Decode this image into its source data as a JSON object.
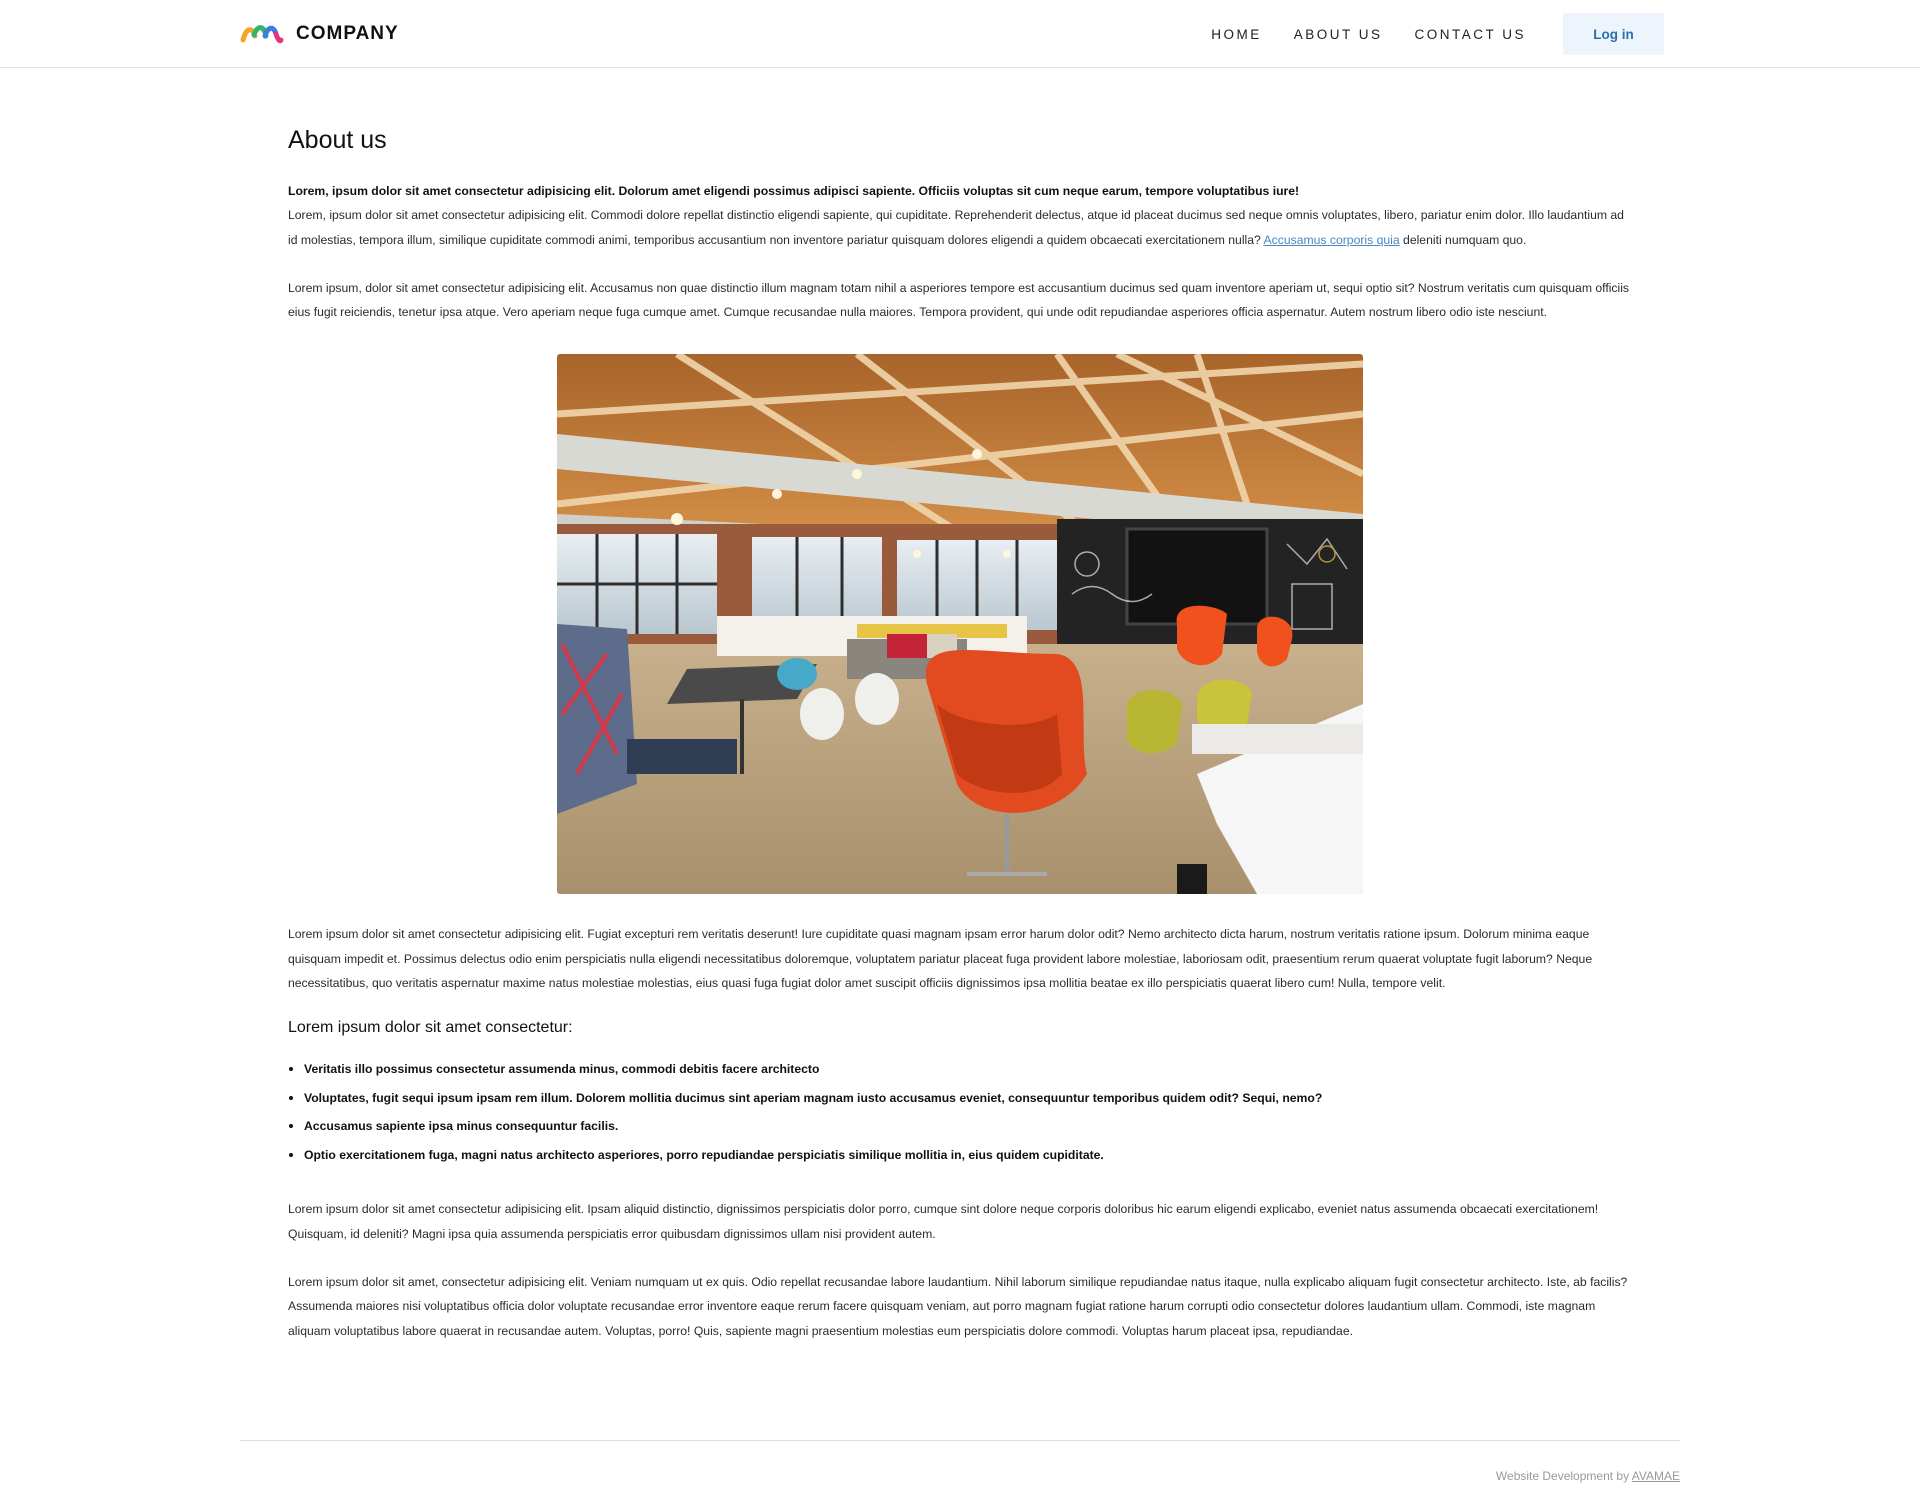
{
  "header": {
    "brand": "COMPANY",
    "nav": [
      "HOME",
      "ABOUT US",
      "CONTACT US"
    ],
    "login": "Log in"
  },
  "main": {
    "title": "About us",
    "intro_bold": "Lorem, ipsum dolor sit amet consectetur adipisicing elit. Dolorum amet eligendi possimus adipisci sapiente. Officiis voluptas sit cum neque earum, tempore voluptatibus iure!",
    "intro_text": "Lorem, ipsum dolor sit amet consectetur adipisicing elit. Commodi dolore repellat distinctio eligendi sapiente, qui cupiditate. Reprehenderit delectus, atque id placeat ducimus sed neque omnis voluptates, libero, pariatur enim dolor. Illo laudantium ad id molestias, tempora illum, similique cupiditate commodi animi, temporibus accusantium non inventore pariatur quisquam dolores eligendi a quidem obcaecati exercitationem nulla? ",
    "intro_link": "Accusamus corporis quia",
    "intro_tail": " deleniti numquam quo.",
    "para2": "Lorem ipsum, dolor sit amet consectetur adipisicing elit. Accusamus non quae distinctio illum magnam totam nihil a asperiores tempore est accusantium ducimus sed quam inventore aperiam ut, sequi optio sit? Nostrum veritatis cum quisquam officiis eius fugit reiciendis, tenetur ipsa atque. Vero aperiam neque fuga cumque amet. Cumque recusandae nulla maiores. Tempora provident, qui unde odit repudiandae asperiores officia aspernatur. Autem nostrum libero odio iste nesciunt.",
    "para3": "Lorem ipsum dolor sit amet consectetur adipisicing elit. Fugiat excepturi rem veritatis deserunt! Iure cupiditate quasi magnam ipsam error harum dolor odit? Nemo architecto dicta harum, nostrum veritatis ratione ipsum. Dolorum minima eaque quisquam impedit et. Possimus delectus odio enim perspiciatis nulla eligendi necessitatibus doloremque, voluptatem pariatur placeat fuga provident labore molestiae, laboriosam odit, praesentium rerum quaerat voluptate fugit laborum? Neque necessitatibus, quo veritatis aspernatur maxime natus molestiae molestias, eius quasi fuga fugiat dolor amet suscipit officiis dignissimos ipsa mollitia beatae ex illo perspiciatis quaerat libero cum! Nulla, tempore velit.",
    "subhead": "Lorem ipsum dolor sit amet consectetur:",
    "bullets": [
      "Veritatis illo possimus consectetur assumenda minus, commodi debitis facere architecto",
      "Voluptates, fugit sequi ipsum ipsam rem illum. Dolorem mollitia ducimus sint aperiam magnam iusto accusamus eveniet, consequuntur temporibus quidem odit? Sequi, nemo?",
      "Accusamus sapiente ipsa minus consequuntur facilis.",
      "Optio exercitationem fuga, magni natus architecto asperiores, porro repudiandae perspiciatis similique mollitia in, eius quidem cupiditate."
    ],
    "para4": "Lorem ipsum dolor sit amet consectetur adipisicing elit. Ipsam aliquid distinctio, dignissimos perspiciatis dolor porro, cumque sint dolore neque corporis doloribus hic earum eligendi explicabo, eveniet natus assumenda obcaecati exercitationem! Quisquam, id deleniti? Magni ipsa quia assumenda perspiciatis error quibusdam dignissimos ullam nisi provident autem.",
    "para5": "Lorem ipsum dolor sit amet, consectetur adipisicing elit. Veniam numquam ut ex quis. Odio repellat recusandae labore laudantium. Nihil laborum similique repudiandae natus itaque, nulla explicabo aliquam fugit consectetur architecto. Iste, ab facilis? Assumenda maiores nisi voluptatibus officia dolor voluptate recusandae error inventore eaque rerum facere quisquam veniam, aut porro magnam fugiat ratione harum corrupti odio consectetur dolores laudantium ullam. Commodi, iste magnam aliquam voluptatibus labore quaerat in recusandae autem. Voluptas, porro! Quis, sapiente magni praesentium molestias eum perspiciatis dolore commodi. Voluptas harum placeat ipsa, repudiandae."
  },
  "footer": {
    "credit": "Website Development by ",
    "credit_link": "AVAMAE"
  },
  "colors": {
    "accent_blue": "#2a6fb0",
    "login_bg": "#edf4fb",
    "link": "#4a86c5"
  },
  "icons": {
    "logo": "company-logo-icon"
  }
}
